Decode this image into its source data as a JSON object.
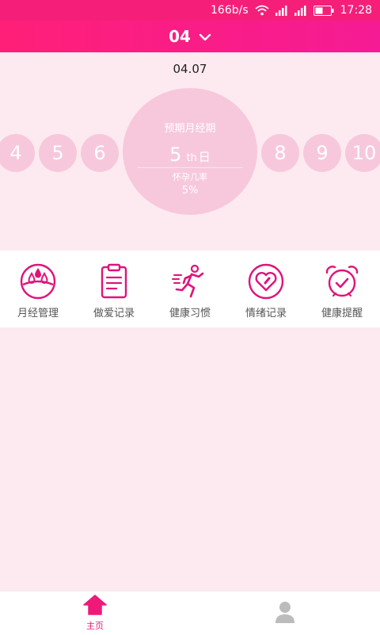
{
  "status_bar": {
    "net_speed": "166b/s",
    "time": "17:28",
    "icons": [
      "wifi-icon",
      "signal-icon",
      "signal-icon",
      "battery-icon"
    ]
  },
  "header": {
    "month": "04",
    "chevron_icon": "chevron-down-icon"
  },
  "calendar": {
    "date": "04.07",
    "left_days": [
      "4",
      "5",
      "6"
    ],
    "right_days": [
      "8",
      "9",
      "10"
    ],
    "current": {
      "title": "预期月经期",
      "day": "5",
      "suffix": "th",
      "unit": "日",
      "pregnancy_label": "怀孕几率",
      "pregnancy_value": "5%"
    }
  },
  "tools": [
    {
      "label": "月经管理",
      "icon": "droplets-icon"
    },
    {
      "label": "做爱记录",
      "icon": "notepad-icon"
    },
    {
      "label": "健康习惯",
      "icon": "runner-icon"
    },
    {
      "label": "情绪记录",
      "icon": "heart-icon"
    },
    {
      "label": "健康提醒",
      "icon": "alarm-clock-icon"
    }
  ],
  "bottom_nav": {
    "home": {
      "label": "主页",
      "icon": "home-icon"
    },
    "profile": {
      "label": "",
      "icon": "person-icon"
    }
  },
  "colors": {
    "accent": "#f0197a",
    "header_gradient_start": "#ff1f78",
    "header_gradient_end": "#f51b94",
    "circle_pink": "#f7c8dc",
    "page_background": "#fceaf0"
  }
}
